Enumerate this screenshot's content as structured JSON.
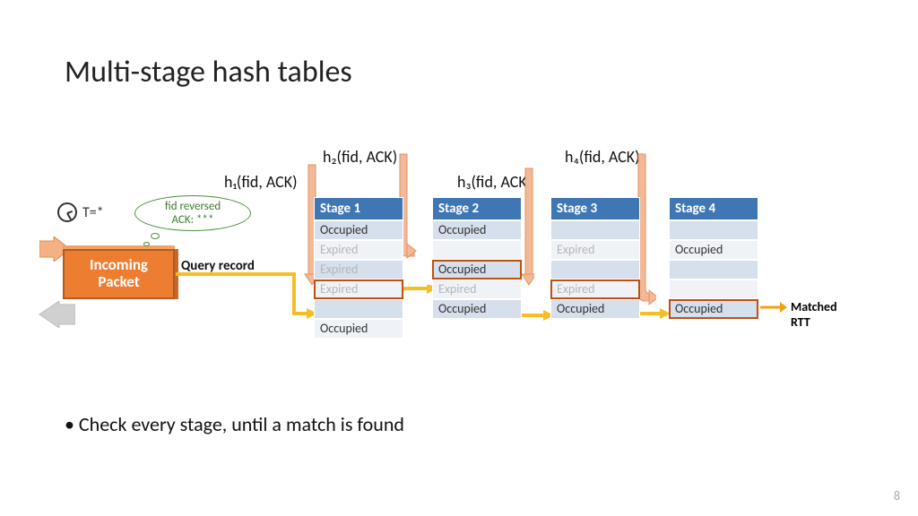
{
  "title": "Multi-stage hash tables",
  "bullet": "• Check every stage, until a match is found",
  "slidenum": "8",
  "clock_label": "T=*",
  "bubble_line1": "fid reversed",
  "bubble_line2": "ACK: ***",
  "packet_line1": "Incoming",
  "packet_line2": "Packet",
  "query_label": "Query record",
  "hash": {
    "h1": "h₁(fid, ACK)",
    "h2": "h₂(fid, ACK)",
    "h3": "h₃(fid, ACK)",
    "h4": "h₄(fid, ACK)"
  },
  "matched_label": "Matched RTT",
  "stages": [
    {
      "header": "Stage 1",
      "rows": [
        {
          "text": "Occupied",
          "cls": "blue"
        },
        {
          "text": "Expired",
          "cls": "light"
        },
        {
          "text": "Expired",
          "cls": "blue",
          "faded": true
        },
        {
          "text": "Expired",
          "cls": "light",
          "sel": true
        },
        {
          "text": "",
          "cls": "blue"
        },
        {
          "text": "Occupied",
          "cls": "light",
          "dark": true
        }
      ]
    },
    {
      "header": "Stage 2",
      "rows": [
        {
          "text": "Occupied",
          "cls": "blue"
        },
        {
          "text": "",
          "cls": "light"
        },
        {
          "text": "Occupied",
          "cls": "blue",
          "sel": true
        },
        {
          "text": "Expired",
          "cls": "light"
        },
        {
          "text": "Occupied",
          "cls": "blue"
        }
      ]
    },
    {
      "header": "Stage 3",
      "rows": [
        {
          "text": "",
          "cls": "blue"
        },
        {
          "text": "Expired",
          "cls": "light"
        },
        {
          "text": "",
          "cls": "blue"
        },
        {
          "text": "Expired",
          "cls": "light",
          "sel": true
        },
        {
          "text": "Occupied",
          "cls": "blue"
        }
      ]
    },
    {
      "header": "Stage 4",
      "rows": [
        {
          "text": "",
          "cls": "blue"
        },
        {
          "text": "Occupied",
          "cls": "light",
          "dark": true
        },
        {
          "text": "",
          "cls": "blue"
        },
        {
          "text": "",
          "cls": "light"
        },
        {
          "text": "Occupied",
          "cls": "blue",
          "sel": true
        }
      ]
    }
  ]
}
